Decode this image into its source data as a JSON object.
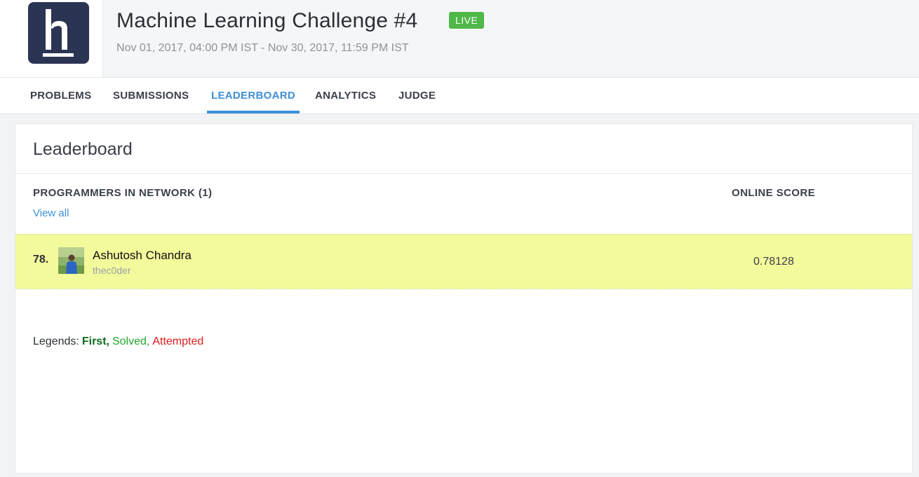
{
  "header": {
    "title": "Machine Learning Challenge #4",
    "badge": "LIVE",
    "dates": "Nov 01, 2017, 04:00 PM IST - Nov 30, 2017, 11:59 PM IST",
    "logo_icon": "hackerearth-logo-icon"
  },
  "tabs": [
    {
      "label": "PROBLEMS",
      "active": false
    },
    {
      "label": "SUBMISSIONS",
      "active": false
    },
    {
      "label": "LEADERBOARD",
      "active": true
    },
    {
      "label": "ANALYTICS",
      "active": false
    },
    {
      "label": "JUDGE",
      "active": false
    }
  ],
  "leaderboard": {
    "title": "Leaderboard",
    "col_programmers": "PROGRAMMERS IN NETWORK (1)",
    "col_score": "ONLINE SCORE",
    "view_all": "View all",
    "rows": [
      {
        "rank": "78.",
        "name": "Ashutosh Chandra",
        "handle": "thec0der",
        "score": "0.78128",
        "highlight_color": "#f3fa9b"
      }
    ]
  },
  "legends": {
    "label": "Legends:",
    "first": "First,",
    "solved": "Solved,",
    "attempted": "Attempted"
  },
  "colors": {
    "accent": "#3e8fd8",
    "live": "#4fb848",
    "first": "#126b1e",
    "solved": "#21a82e",
    "attempted": "#e01b1b"
  }
}
